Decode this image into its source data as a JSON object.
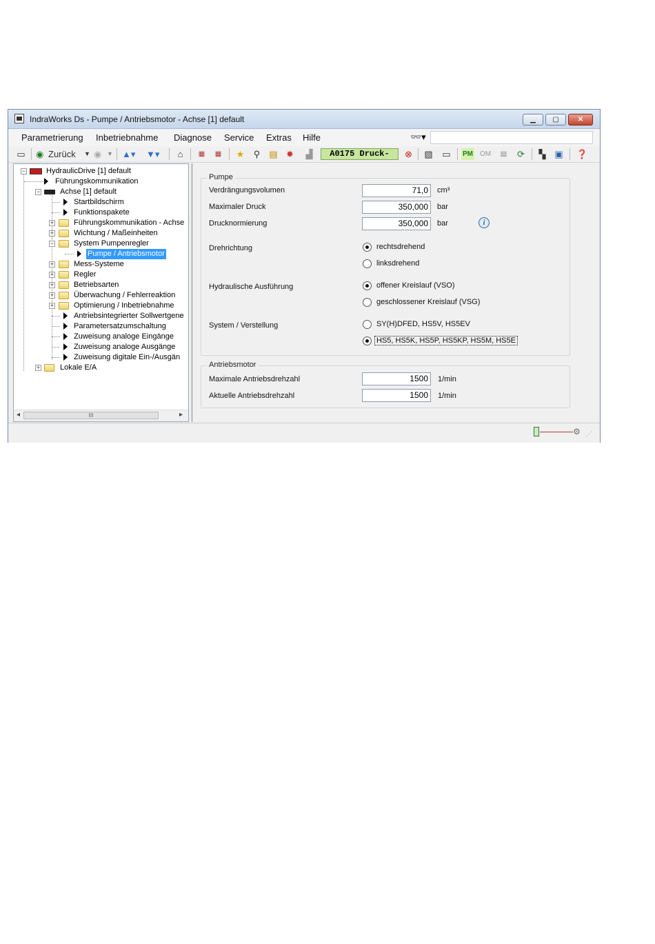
{
  "window": {
    "title": "IndraWorks Ds - Pumpe / Antriebsmotor - Achse [1] default"
  },
  "menu": [
    "Parametrierung",
    "Inbetriebnahme",
    "Diagnose",
    "Service",
    "Extras",
    "Hilfe"
  ],
  "toolbar": {
    "back_label": "Zurück",
    "status_text": "A0175 Druck-",
    "pm_label": "PM",
    "om_label": "OM"
  },
  "tree": {
    "root": "HydraulicDrive [1] default",
    "fuehrungskommunikation": "Führungskommunikation",
    "achse": "Achse [1] default",
    "startbildschirm": "Startbildschirm",
    "funktionspakete": "Funktionspakete",
    "fuehrungskommunikation_achse": "Führungskommunikation - Achse",
    "wichtung": "Wichtung / Maßeinheiten",
    "system_pumpenregler": "System Pumpenregler",
    "pumpe_antriebsmotor": "Pumpe / Antriebsmotor",
    "mess_systeme": "Mess-Systeme",
    "regler": "Regler",
    "betriebsarten": "Betriebsarten",
    "ueberwachung": "Überwachung / Fehlerreaktion",
    "optimierung": "Optimierung / Inbetriebnahme",
    "sollwertgen": "Antriebsintegrierter Sollwertgene",
    "parametersatz": "Parametersatzumschaltung",
    "analog_ein": "Zuweisung analoge Eingänge",
    "analog_aus": "Zuweisung analoge Ausgänge",
    "digital": "Zuweisung digitale Ein-/Ausgän",
    "lokale_ea": "Lokale E/A",
    "scroll_thumb": "III"
  },
  "pumpe": {
    "title": "Pumpe",
    "verdraengung_label": "Verdrängungsvolumen",
    "verdraengung_value": "71,0",
    "verdraengung_unit": "cm³",
    "druck_label": "Maximaler Druck",
    "druck_value": "350,000",
    "druck_unit": "bar",
    "normierung_label": "Drucknormierung",
    "normierung_value": "350,000",
    "normierung_unit": "bar",
    "drehrichtung_label": "Drehrichtung",
    "rechts": "rechtsdrehend",
    "links": "linksdrehend",
    "ausfuehrung_label": "Hydraulische Ausführung",
    "offen": "offener Kreislauf (VSO)",
    "geschlossen": "geschlossener Kreislauf (VSG)",
    "system_label": "System / Verstellung",
    "sy": "SY(H)DFED, HS5V, HS5EV",
    "hs5": "HS5, HS5K, HS5P, HS5KP, HS5M, HS5E"
  },
  "motor": {
    "title": "Antriebsmotor",
    "max_label": "Maximale Antriebsdrehzahl",
    "max_value": "1500",
    "max_unit": "1/min",
    "akt_label": "Aktuelle Antriebsdrehzahl",
    "akt_value": "1500",
    "akt_unit": "1/min"
  }
}
